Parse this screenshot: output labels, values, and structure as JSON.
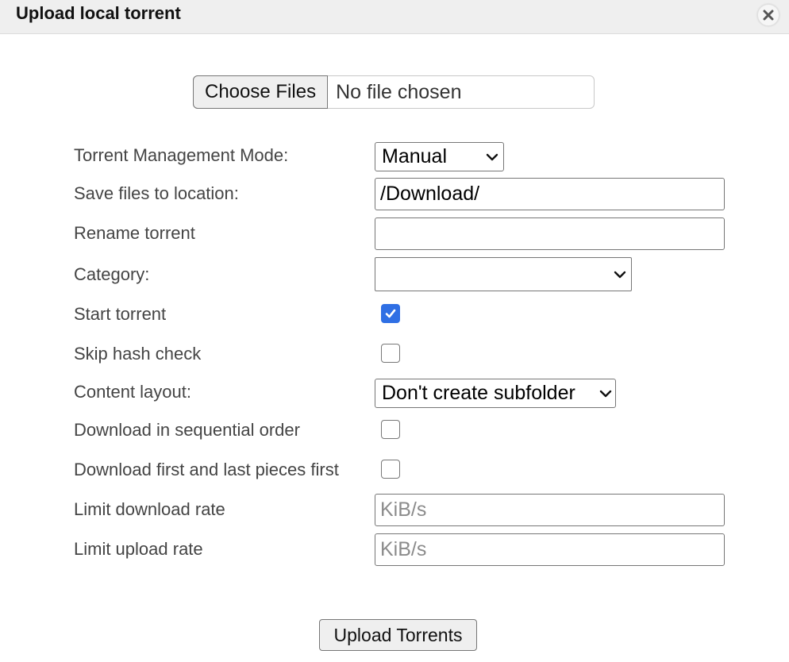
{
  "dialog": {
    "title": "Upload local torrent"
  },
  "file_picker": {
    "button_label": "Choose Files",
    "status_text": "No file chosen"
  },
  "form": {
    "management_mode": {
      "label": "Torrent Management Mode:",
      "value": "Manual"
    },
    "save_location": {
      "label": "Save files to location:",
      "value": "/Download/"
    },
    "rename": {
      "label": "Rename torrent",
      "value": ""
    },
    "category": {
      "label": "Category:",
      "value": ""
    },
    "start_torrent": {
      "label": "Start torrent",
      "checked": true
    },
    "skip_hash": {
      "label": "Skip hash check",
      "checked": false
    },
    "content_layout": {
      "label": "Content layout:",
      "value": "Don't create subfolder"
    },
    "sequential": {
      "label": "Download in sequential order",
      "checked": false
    },
    "first_last": {
      "label": "Download first and last pieces first",
      "checked": false
    },
    "dl_limit": {
      "label": "Limit download rate",
      "placeholder": "KiB/s"
    },
    "ul_limit": {
      "label": "Limit upload rate",
      "placeholder": "KiB/s"
    }
  },
  "actions": {
    "upload_label": "Upload Torrents"
  },
  "colors": {
    "checkbox_checked": "#2f6fe4",
    "titlebar_bg": "#efefef"
  }
}
